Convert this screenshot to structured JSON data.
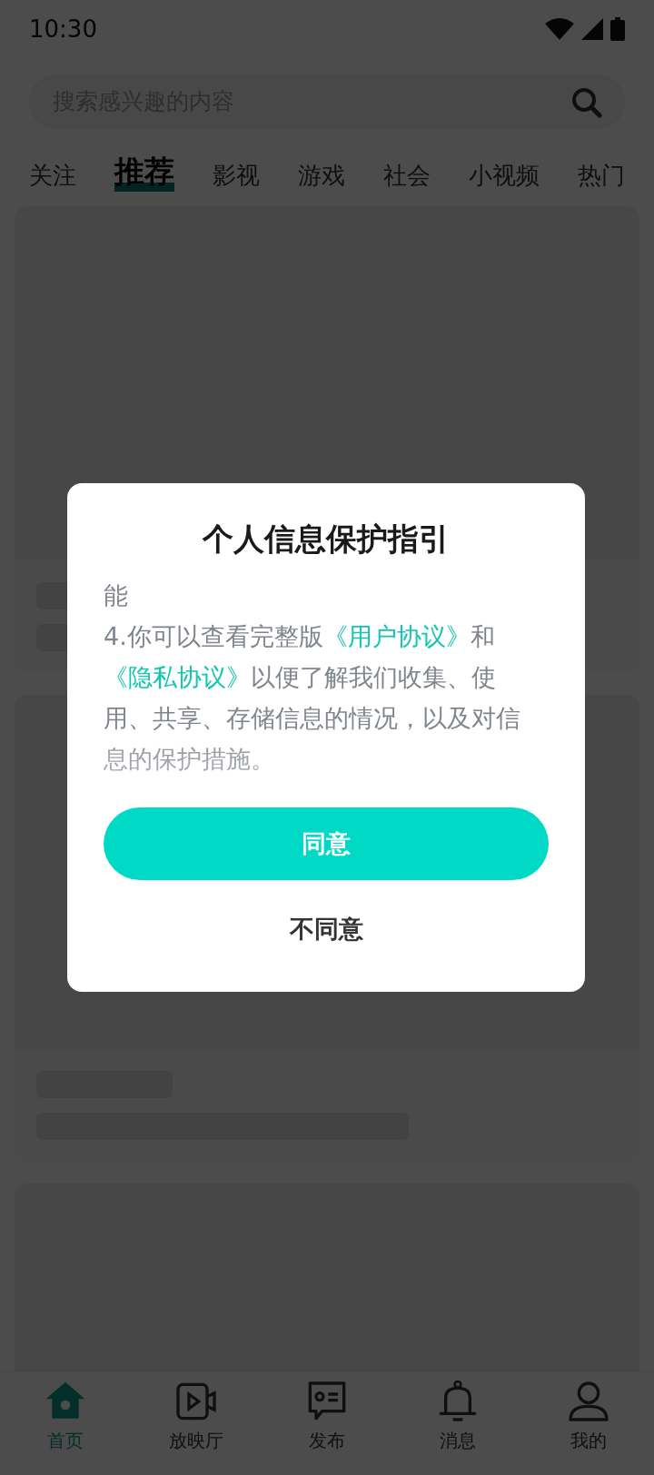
{
  "status_bar": {
    "time": "10:30"
  },
  "search": {
    "placeholder": "搜索感兴趣的内容"
  },
  "tabs": [
    {
      "label": "关注",
      "selected": false
    },
    {
      "label": "推荐",
      "selected": true
    },
    {
      "label": "影视",
      "selected": false
    },
    {
      "label": "游戏",
      "selected": false
    },
    {
      "label": "社会",
      "selected": false
    },
    {
      "label": "小视频",
      "selected": false
    },
    {
      "label": "热门",
      "selected": false
    }
  ],
  "bottom_nav": [
    {
      "label": "首页",
      "kind": "home",
      "selected": true
    },
    {
      "label": "放映厅",
      "kind": "video",
      "selected": false
    },
    {
      "label": "发布",
      "kind": "post",
      "selected": false
    },
    {
      "label": "消息",
      "kind": "bell",
      "selected": false
    },
    {
      "label": "我的",
      "kind": "person",
      "selected": false
    }
  ],
  "dialog": {
    "title": "个人信息保护指引",
    "paragraphs": [
      [
        {
          "text": "能"
        }
      ],
      [
        {
          "text": "4.你可以查看完整版"
        },
        {
          "text": "《用户协议》",
          "kind": "link"
        },
        {
          "text": "和"
        },
        {
          "text": "《隐私协议》",
          "kind": "link"
        },
        {
          "text": "以便了解我们收集、使用、共享、存储信息的情况，以及对信息的保护措施。"
        }
      ]
    ],
    "agree_button": "同意",
    "disagree_button": "不同意"
  }
}
